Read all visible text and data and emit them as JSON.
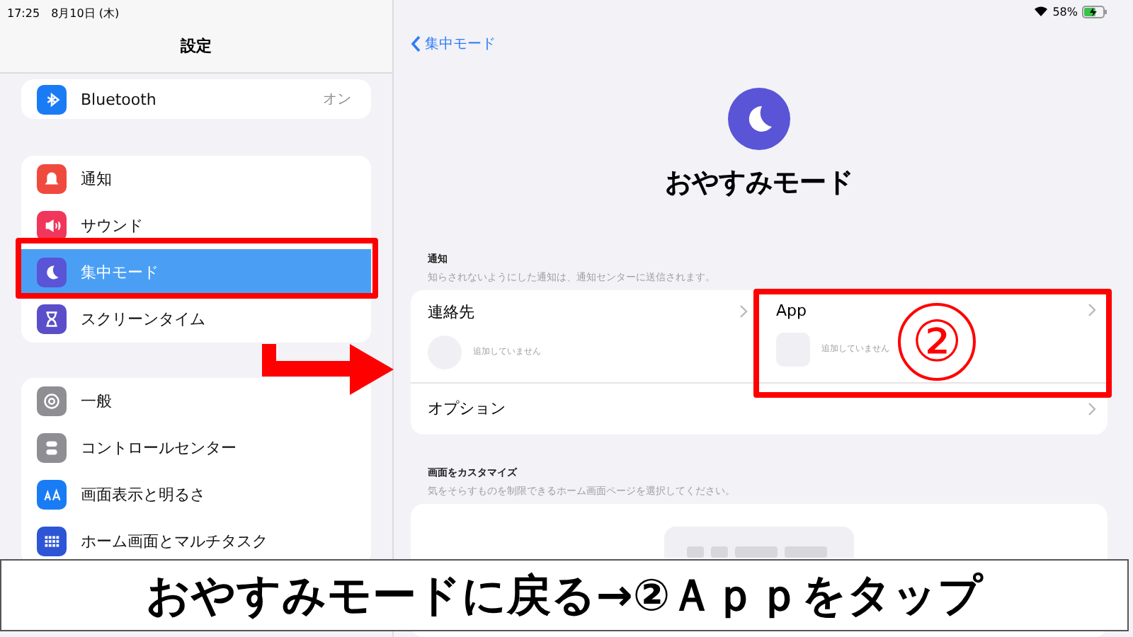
{
  "status_bar": {
    "time": "17:25",
    "date": "8月10日 (木)",
    "battery": "58%"
  },
  "sidebar": {
    "title": "設定",
    "groups": [
      [
        {
          "label": "Bluetooth",
          "value": "オン",
          "color": "#1a7cf5",
          "selected": false,
          "highlighted": false
        }
      ],
      [
        {
          "label": "通知",
          "color": "#f04a3e",
          "selected": false,
          "highlighted": false
        },
        {
          "label": "サウンド",
          "color": "#f0365a",
          "selected": false,
          "highlighted": false
        },
        {
          "label": "集中モード",
          "color": "#5a54d6",
          "selected": true,
          "highlighted": true
        },
        {
          "label": "スクリーンタイム",
          "color": "#5a4fc9",
          "selected": false,
          "highlighted": false
        }
      ],
      [
        {
          "label": "一般",
          "color": "#8e8e93",
          "selected": false,
          "highlighted": false
        },
        {
          "label": "コントロールセンター",
          "color": "#8e8e93",
          "selected": false,
          "highlighted": false
        },
        {
          "label": "画面表示と明るさ",
          "color": "#1a7cf5",
          "selected": false,
          "highlighted": false
        },
        {
          "label": "ホーム画面とマルチタスク",
          "color": "#2d55d6",
          "selected": false,
          "highlighted": false
        }
      ]
    ]
  },
  "detail": {
    "back": "集中モード",
    "title": "おやすみモード",
    "notifications": {
      "header": "通知",
      "note": "知らされないようにした通知は、通知センターに送信されます。",
      "columns": [
        {
          "kind": "contacts",
          "label": "連絡先",
          "empty": "追加していません",
          "highlighted": false
        },
        {
          "kind": "apps",
          "label": "App",
          "empty": "追加していません",
          "highlighted": true
        }
      ],
      "options": "オプション"
    },
    "customize": {
      "header": "画面をカスタマイズ",
      "note": "気をそらすものを制限できるホーム画面ページを選択してください。"
    }
  },
  "annotation": {
    "step_mark": "②",
    "caption": "おやすみモードに戻る→②Ａｐｐをタップ"
  }
}
